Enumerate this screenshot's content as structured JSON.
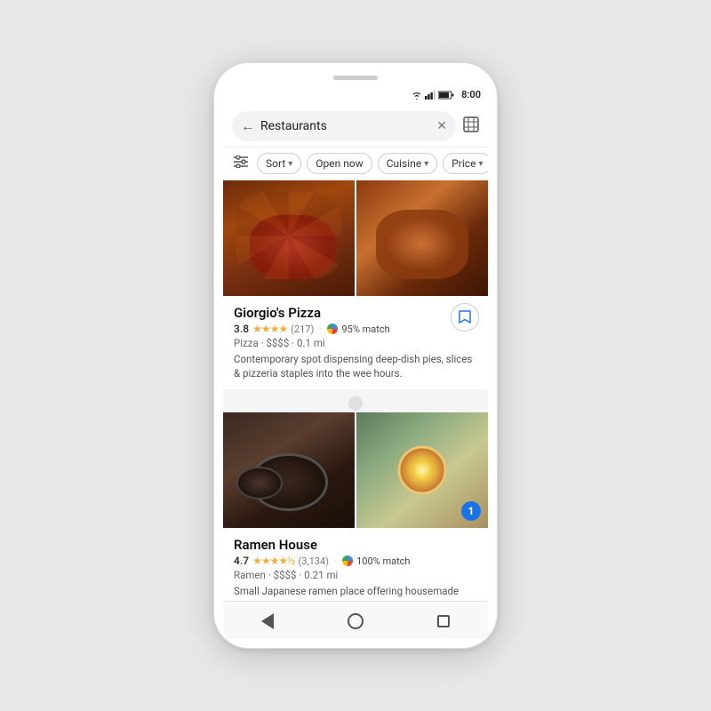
{
  "statusBar": {
    "time": "8:00",
    "wifiIcon": "▾",
    "signalIcon": "▮▮▮",
    "batteryIcon": "🔋"
  },
  "searchBar": {
    "backIcon": "←",
    "placeholder": "Restaurants",
    "clearIcon": "✕",
    "mapIcon": "⊞"
  },
  "filters": [
    {
      "id": "sort",
      "label": "Sort",
      "hasChevron": true
    },
    {
      "id": "open-now",
      "label": "Open now",
      "hasChevron": false
    },
    {
      "id": "cuisine",
      "label": "Cuisine",
      "hasChevron": true
    },
    {
      "id": "price",
      "label": "Price",
      "hasChevron": true
    }
  ],
  "restaurants": [
    {
      "id": "giorgios-pizza",
      "name": "Giorgio's Pizza",
      "rating": "3.8",
      "stars": "★★★★",
      "reviewCount": "(217)",
      "matchPercent": "95% match",
      "category": "Pizza",
      "priceLevel": "$$$$",
      "distance": "0.1 mi",
      "description": "Contemporary spot dispensing deep-dish pies, slices & pizzeria staples into the wee hours.",
      "hasBookmark": true,
      "hasBadge": false
    },
    {
      "id": "ramen-house",
      "name": "Ramen House",
      "rating": "4.7",
      "stars": "★★★★½",
      "reviewCount": "(3,134)",
      "matchPercent": "100% match",
      "category": "Ramen",
      "priceLevel": "$$$$",
      "distance": "0.21 mi",
      "description": "Small Japanese ramen place offering housemade noodles, plus dumplings & sake.",
      "hasBookmark": false,
      "hasBadge": true,
      "badgeNum": "1"
    }
  ],
  "navBar": {
    "back": "back",
    "home": "home",
    "recent": "recent"
  }
}
